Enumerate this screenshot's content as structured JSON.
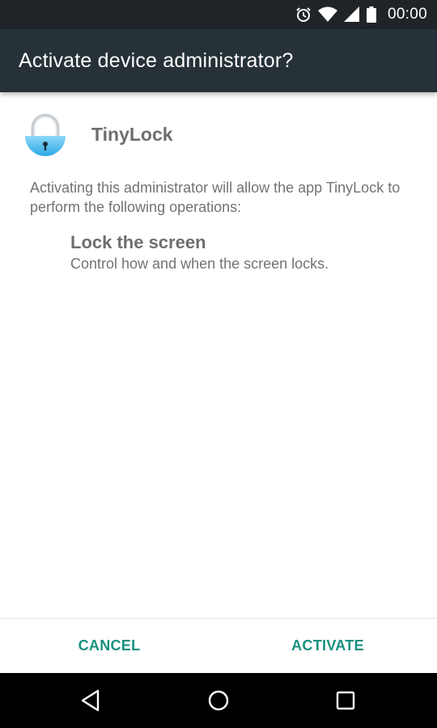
{
  "status_bar": {
    "icons": [
      "alarm-icon",
      "wifi-icon",
      "cell-signal-icon",
      "battery-icon"
    ],
    "time": "00:00"
  },
  "action_bar": {
    "title": "Activate device administrator?"
  },
  "app": {
    "icon": "padlock-icon",
    "name": "TinyLock"
  },
  "description": "Activating this administrator will allow the app TinyLock to perform the following operations:",
  "policies": [
    {
      "title": "Lock the screen",
      "description": "Control how and when the screen locks."
    }
  ],
  "buttons": {
    "cancel": "CANCEL",
    "activate": "ACTIVATE"
  },
  "nav_bar": {
    "icons": [
      "back-icon",
      "home-icon",
      "recents-icon"
    ]
  },
  "colors": {
    "accent": "#17907f",
    "action_bar": "#263238",
    "status_bar": "#1e2428"
  }
}
